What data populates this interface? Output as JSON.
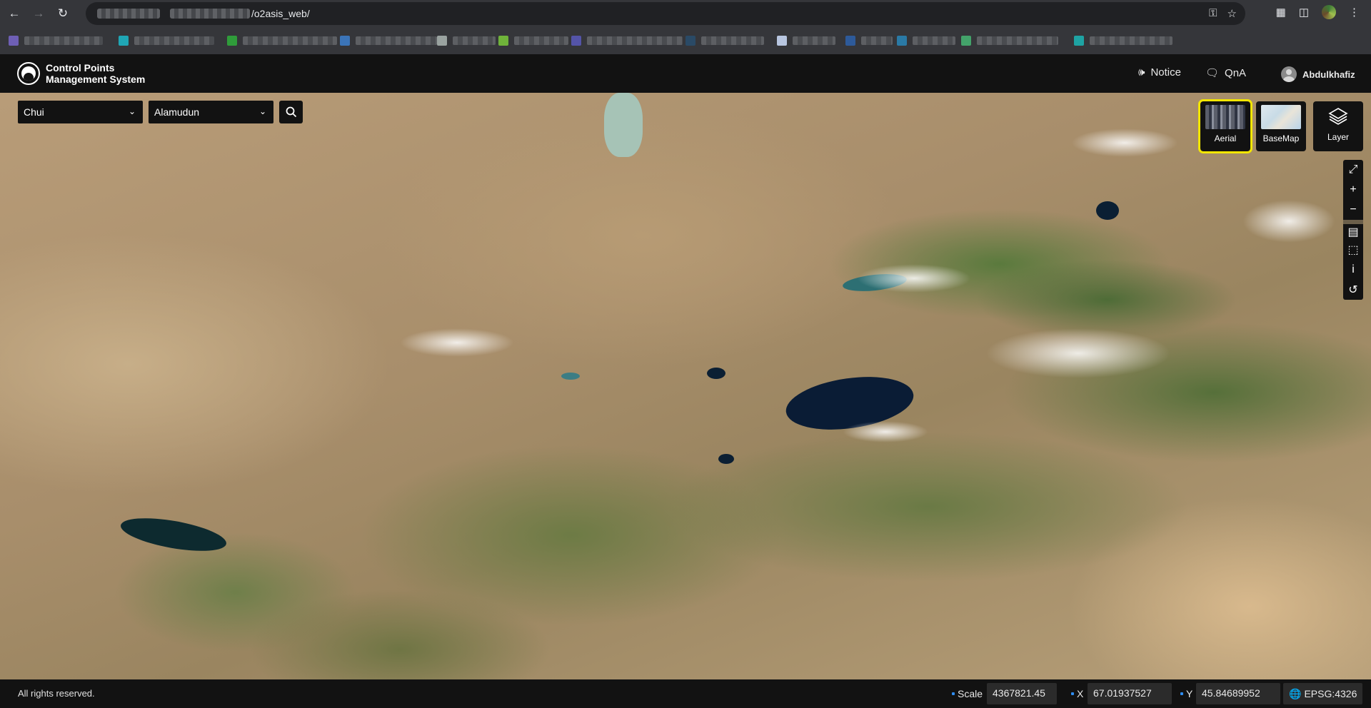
{
  "browser": {
    "url_suffix": "/o2asis_web/"
  },
  "header": {
    "title_line1": "Control Points",
    "title_line2": "Management System",
    "notice_label": "Notice",
    "qna_label": "QnA",
    "user_name": "Abdulkhafiz"
  },
  "search": {
    "region": "Chui",
    "district": "Alamudun"
  },
  "map_types": {
    "aerial_label": "Aerial",
    "basemap_label": "BaseMap",
    "layer_label": "Layer",
    "selected": "Aerial",
    "highlight_color": "#f2e600"
  },
  "tools": [
    "fullscreen-icon",
    "zoom-in-icon",
    "zoom-out-icon",
    "measure-distance-icon",
    "measure-area-icon",
    "info-icon",
    "reset-icon"
  ],
  "footer": {
    "rights": "All rights reserved.",
    "scale_label": "Scale",
    "scale_value": "4367821.45",
    "x_label": "X",
    "x_value": "67.01937527",
    "y_label": "Y",
    "y_value": "45.84689952",
    "crs": "EPSG:4326"
  }
}
